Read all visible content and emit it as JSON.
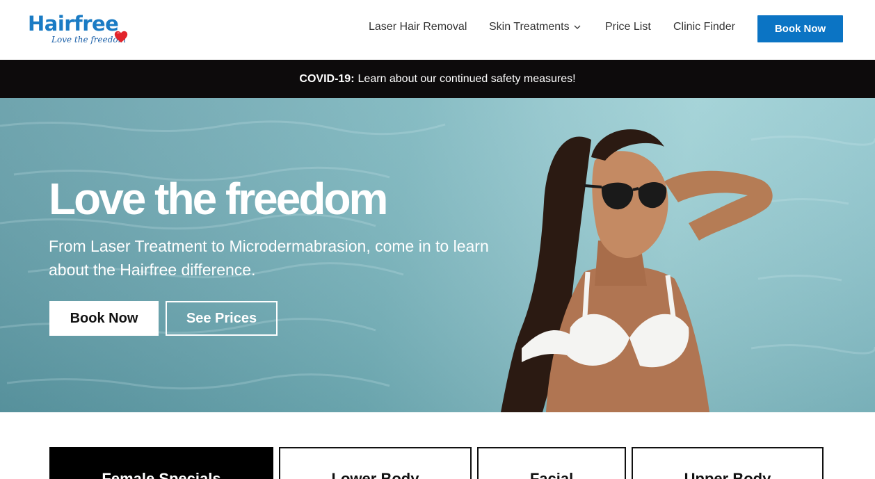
{
  "logo": {
    "name": "Hairfree",
    "tagline": "Love the freedom"
  },
  "nav": {
    "items": [
      {
        "label": "Laser Hair Removal"
      },
      {
        "label": "Skin Treatments",
        "has_dropdown": true
      },
      {
        "label": "Price List"
      },
      {
        "label": "Clinic Finder"
      }
    ],
    "cta_label": "Book Now"
  },
  "notice": {
    "bold": "COVID-19:",
    "text": "Learn about our continued safety measures!"
  },
  "hero": {
    "title": "Love the freedom",
    "subtitle": "From Laser Treatment to Microdermabrasion, come in to learn about the Hairfree difference.",
    "primary_button": "Book Now",
    "secondary_button": "See Prices"
  },
  "categories": [
    {
      "label": "Female Specials",
      "active": true
    },
    {
      "label": "Lower Body",
      "active": false
    },
    {
      "label": "Facial",
      "active": false
    },
    {
      "label": "Upper Body",
      "active": false
    }
  ],
  "colors": {
    "brand_blue": "#0b74c4",
    "logo_blue": "#1a7bc4",
    "notice_bg": "#0d0b0c",
    "heart_red": "#e2242b"
  },
  "icons": {
    "dropdown": "chevron-down-icon",
    "logo_mark": "heart-icon"
  }
}
